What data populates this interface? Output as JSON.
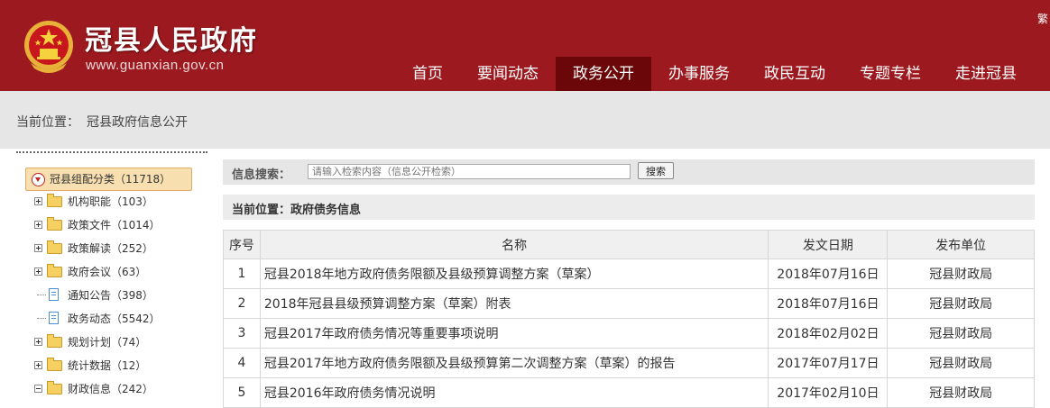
{
  "header": {
    "site_title": "冠县人民政府",
    "site_url": "www.guanxian.gov.cn",
    "lang_link": "繁",
    "nav": [
      {
        "label": "首页",
        "active": false
      },
      {
        "label": "要闻动态",
        "active": false
      },
      {
        "label": "政务公开",
        "active": true
      },
      {
        "label": "办事服务",
        "active": false
      },
      {
        "label": "政民互动",
        "active": false
      },
      {
        "label": "专题专栏",
        "active": false
      },
      {
        "label": "走进冠县",
        "active": false
      }
    ]
  },
  "breadcrumb": {
    "prefix": "当前位置：",
    "path": "冠县政府信息公开"
  },
  "sidebar": {
    "root": "冠县组配分类（11718）",
    "items": [
      {
        "label": "机构职能（103）",
        "type": "folder",
        "expand": "plus"
      },
      {
        "label": "政策文件（1014）",
        "type": "folder",
        "expand": "plus"
      },
      {
        "label": "政策解读（252）",
        "type": "folder",
        "expand": "plus"
      },
      {
        "label": "政府会议（63）",
        "type": "folder",
        "expand": "plus"
      },
      {
        "label": "通知公告（398）",
        "type": "doc",
        "expand": "none"
      },
      {
        "label": "政务动态（5542）",
        "type": "doc",
        "expand": "none"
      },
      {
        "label": "规划计划（74）",
        "type": "folder",
        "expand": "plus"
      },
      {
        "label": "统计数据（12）",
        "type": "folder",
        "expand": "plus"
      },
      {
        "label": "财政信息（242）",
        "type": "folder",
        "expand": "minus"
      }
    ]
  },
  "search": {
    "label": "信息搜索：",
    "placeholder": "请输入检索内容（信息公开检索）",
    "button": "搜索"
  },
  "section": {
    "title": "当前位置：政府债务信息"
  },
  "table": {
    "headers": [
      "序号",
      "名称",
      "发文日期",
      "发布单位"
    ],
    "rows": [
      {
        "no": "1",
        "name": "冠县2018年地方政府债务限额及县级预算调整方案（草案）",
        "date": "2018年07月16日",
        "unit": "冠县财政局"
      },
      {
        "no": "2",
        "name": "2018年冠县县级预算调整方案（草案）附表",
        "date": "2018年07月16日",
        "unit": "冠县财政局"
      },
      {
        "no": "3",
        "name": "冠县2017年政府债务情况等重要事项说明",
        "date": "2018年02月02日",
        "unit": "冠县财政局"
      },
      {
        "no": "4",
        "name": "冠县2017年地方政府债务限额及县级预算第二次调整方案（草案）的报告",
        "date": "2017年07月17日",
        "unit": "冠县财政局"
      },
      {
        "no": "5",
        "name": "冠县2016年政府债务情况说明",
        "date": "2017年02月10日",
        "unit": "冠县财政局"
      }
    ]
  },
  "colors": {
    "header_bg": "#9c1a1f",
    "nav_active": "#6b0709",
    "crumb_bg": "#e6e6e6"
  }
}
